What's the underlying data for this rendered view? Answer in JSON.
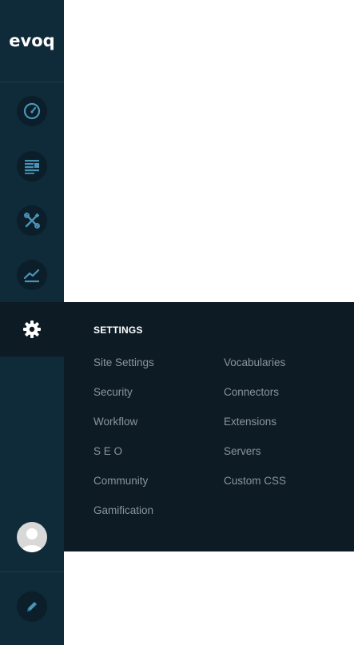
{
  "brand": {
    "logo_text": "evoq",
    "accent_red": "#e8394a",
    "accent_blue": "#2a9fd6"
  },
  "sidebar": {
    "background": "#0f2a39",
    "items": [
      {
        "icon": "speedometer-icon",
        "name": "dashboard"
      },
      {
        "icon": "document-icon",
        "name": "content"
      },
      {
        "icon": "tools-icon",
        "name": "manage"
      },
      {
        "icon": "chart-icon",
        "name": "analytics"
      },
      {
        "icon": "gear-icon",
        "name": "settings",
        "active": true
      }
    ],
    "avatar_icon": "user-avatar-icon",
    "edit_icon": "pencil-icon"
  },
  "settings_menu": {
    "title": "SETTINGS",
    "column1": [
      "Site Settings",
      "Security",
      "Workflow",
      "S E O",
      "Community",
      "Gamification"
    ],
    "column2": [
      "Vocabularies",
      "Connectors",
      "Extensions",
      "Servers",
      "Custom CSS"
    ]
  }
}
